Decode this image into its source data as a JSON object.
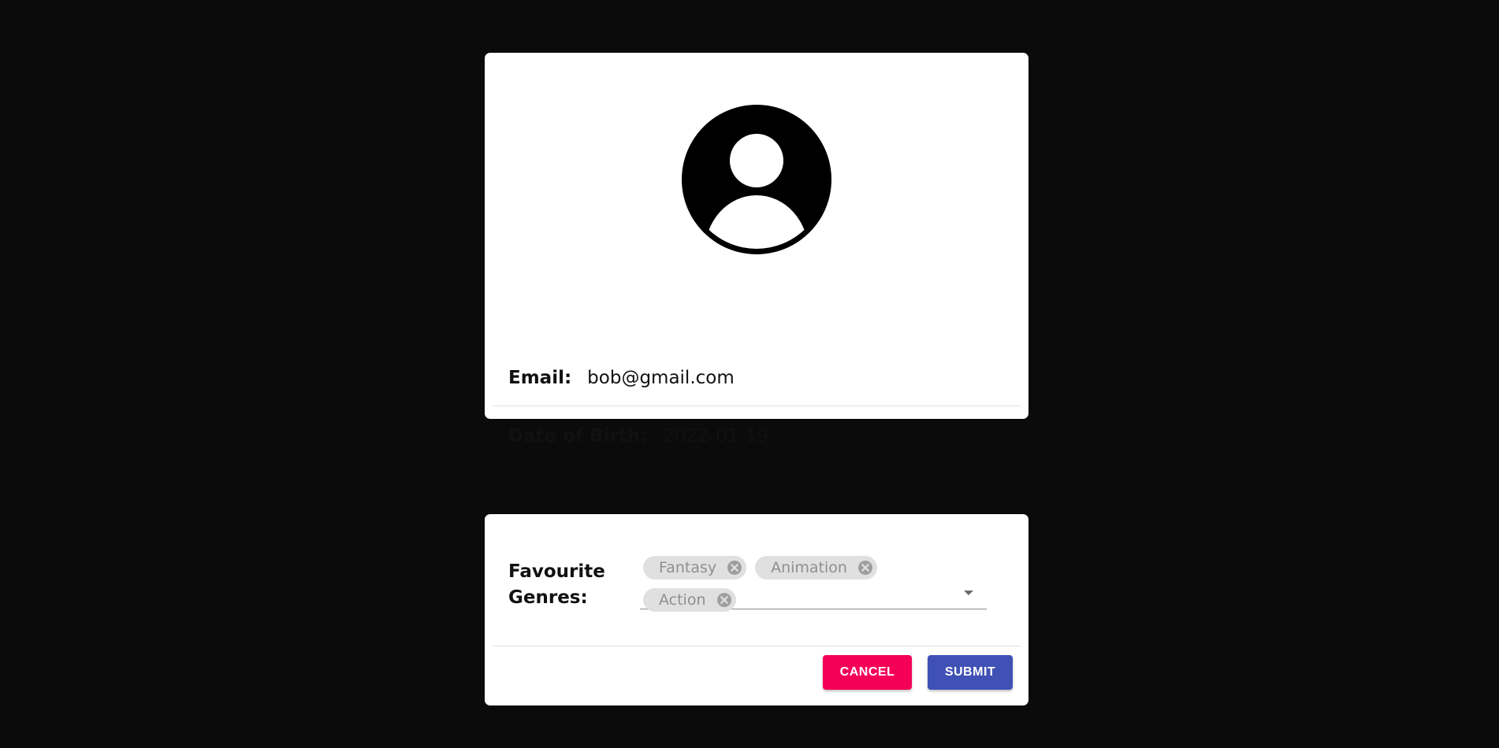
{
  "profile": {
    "avatar_icon": "account-circle-icon",
    "email_label": "Email:",
    "email_value": "bob@gmail.com",
    "dob_label": "Date of Birth:",
    "dob_value": "2022-01-19"
  },
  "genres": {
    "label": "Favourite Genres:",
    "selected": [
      {
        "label": "Fantasy",
        "remove_icon": "cancel-circle-icon"
      },
      {
        "label": "Animation",
        "remove_icon": "cancel-circle-icon"
      },
      {
        "label": "Action",
        "remove_icon": "cancel-circle-icon"
      }
    ],
    "dropdown_icon": "arrow-drop-down-icon"
  },
  "actions": {
    "cancel_label": "CANCEL",
    "submit_label": "SUBMIT"
  },
  "colors": {
    "background": "#0b0b0b",
    "cancel": "#f50057",
    "submit": "#3f51b5",
    "chip": "#e0e0e0"
  }
}
